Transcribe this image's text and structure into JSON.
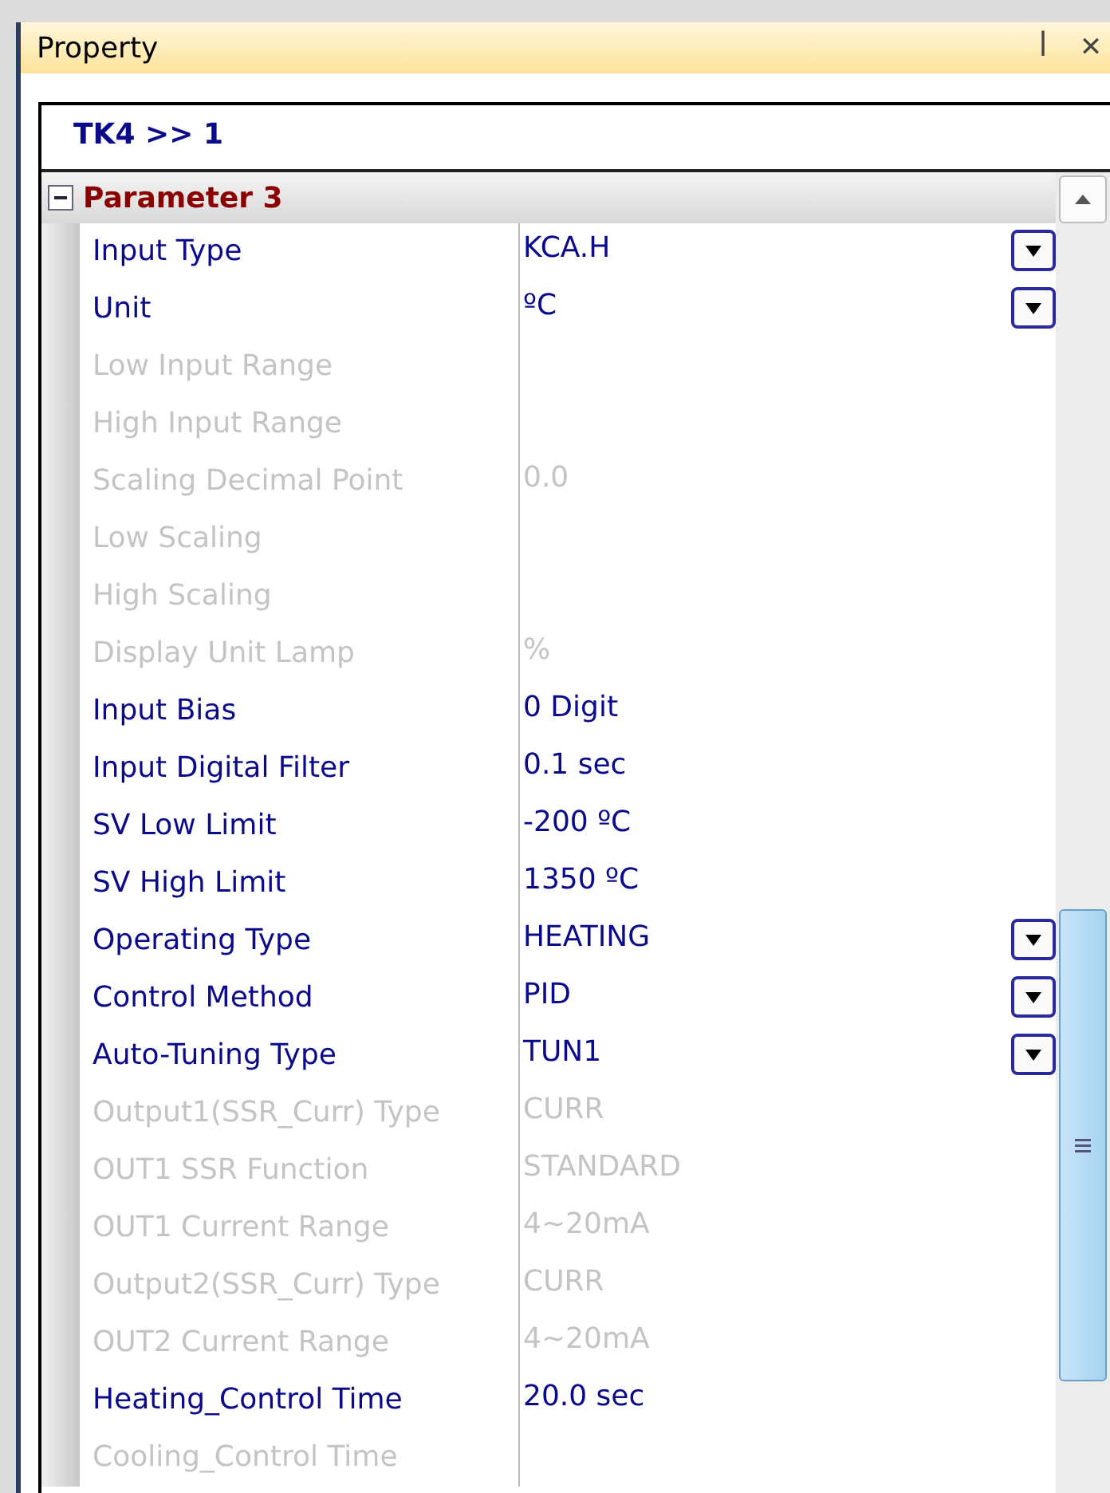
{
  "panel": {
    "title": "Property",
    "pin_icon": "ꟾ",
    "close_icon": "✕"
  },
  "breadcrumb": "TK4 >> 1",
  "category": {
    "name": "Parameter 3",
    "expanded": true
  },
  "rows": [
    {
      "name": "Input Type",
      "value": "KCA.H",
      "disabled": false,
      "dropdown": true
    },
    {
      "name": "Unit",
      "value": "ºC",
      "disabled": false,
      "dropdown": true
    },
    {
      "name": "Low Input Range",
      "disabled": true,
      "dropdown": false
    },
    {
      "name": "High Input Range",
      "disabled": true,
      "dropdown": false
    },
    {
      "name": "Scaling Decimal Point",
      "value": "0.0",
      "disabled": true,
      "dropdown": false
    },
    {
      "name": "Low Scaling",
      "disabled": true,
      "dropdown": false
    },
    {
      "name": "High Scaling",
      "disabled": true,
      "dropdown": false
    },
    {
      "name": "Display Unit Lamp",
      "value": "%",
      "disabled": true,
      "dropdown": false
    },
    {
      "name": "Input Bias",
      "value": "0 Digit",
      "disabled": false,
      "dropdown": false
    },
    {
      "name": "Input Digital Filter",
      "value": "0.1 sec",
      "disabled": false,
      "dropdown": false
    },
    {
      "name": "SV Low Limit",
      "value": "-200 ºC",
      "disabled": false,
      "dropdown": false
    },
    {
      "name": "SV High Limit",
      "value": "1350 ºC",
      "disabled": false,
      "dropdown": false
    },
    {
      "name": "Operating Type",
      "value": "HEATING",
      "disabled": false,
      "dropdown": true
    },
    {
      "name": "Control Method",
      "value": "PID",
      "disabled": false,
      "dropdown": true
    },
    {
      "name": "Auto-Tuning Type",
      "value": "TUN1",
      "disabled": false,
      "dropdown": true
    },
    {
      "name": "Output1(SSR_Curr) Type",
      "value": "CURR",
      "disabled": true,
      "dropdown": false
    },
    {
      "name": "OUT1 SSR Function",
      "value": "STANDARD",
      "disabled": true,
      "dropdown": false
    },
    {
      "name": "OUT1 Current Range",
      "value": "4~20mA",
      "disabled": true,
      "dropdown": false
    },
    {
      "name": "Output2(SSR_Curr) Type",
      "value": "CURR",
      "disabled": true,
      "dropdown": false
    },
    {
      "name": "OUT2 Current Range",
      "value": "4~20mA",
      "disabled": true,
      "dropdown": false
    },
    {
      "name": "Heating_Control Time",
      "value": "20.0 sec",
      "disabled": false,
      "dropdown": false
    },
    {
      "name": "Cooling_Control Time",
      "disabled": true,
      "dropdown": false
    }
  ]
}
